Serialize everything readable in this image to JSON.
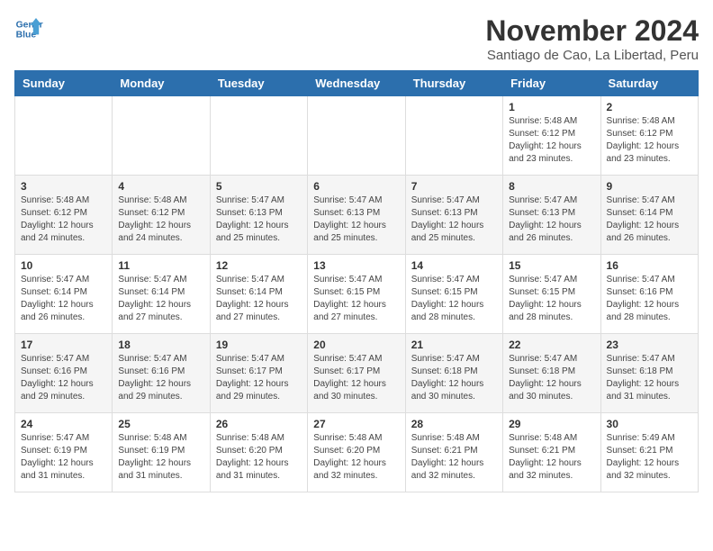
{
  "logo": {
    "text_line1": "General",
    "text_line2": "Blue"
  },
  "header": {
    "title": "November 2024",
    "subtitle": "Santiago de Cao, La Libertad, Peru"
  },
  "weekdays": [
    "Sunday",
    "Monday",
    "Tuesday",
    "Wednesday",
    "Thursday",
    "Friday",
    "Saturday"
  ],
  "weeks": [
    [
      {
        "day": "",
        "info": ""
      },
      {
        "day": "",
        "info": ""
      },
      {
        "day": "",
        "info": ""
      },
      {
        "day": "",
        "info": ""
      },
      {
        "day": "",
        "info": ""
      },
      {
        "day": "1",
        "info": "Sunrise: 5:48 AM\nSunset: 6:12 PM\nDaylight: 12 hours\nand 23 minutes."
      },
      {
        "day": "2",
        "info": "Sunrise: 5:48 AM\nSunset: 6:12 PM\nDaylight: 12 hours\nand 23 minutes."
      }
    ],
    [
      {
        "day": "3",
        "info": "Sunrise: 5:48 AM\nSunset: 6:12 PM\nDaylight: 12 hours\nand 24 minutes."
      },
      {
        "day": "4",
        "info": "Sunrise: 5:48 AM\nSunset: 6:12 PM\nDaylight: 12 hours\nand 24 minutes."
      },
      {
        "day": "5",
        "info": "Sunrise: 5:47 AM\nSunset: 6:13 PM\nDaylight: 12 hours\nand 25 minutes."
      },
      {
        "day": "6",
        "info": "Sunrise: 5:47 AM\nSunset: 6:13 PM\nDaylight: 12 hours\nand 25 minutes."
      },
      {
        "day": "7",
        "info": "Sunrise: 5:47 AM\nSunset: 6:13 PM\nDaylight: 12 hours\nand 25 minutes."
      },
      {
        "day": "8",
        "info": "Sunrise: 5:47 AM\nSunset: 6:13 PM\nDaylight: 12 hours\nand 26 minutes."
      },
      {
        "day": "9",
        "info": "Sunrise: 5:47 AM\nSunset: 6:14 PM\nDaylight: 12 hours\nand 26 minutes."
      }
    ],
    [
      {
        "day": "10",
        "info": "Sunrise: 5:47 AM\nSunset: 6:14 PM\nDaylight: 12 hours\nand 26 minutes."
      },
      {
        "day": "11",
        "info": "Sunrise: 5:47 AM\nSunset: 6:14 PM\nDaylight: 12 hours\nand 27 minutes."
      },
      {
        "day": "12",
        "info": "Sunrise: 5:47 AM\nSunset: 6:14 PM\nDaylight: 12 hours\nand 27 minutes."
      },
      {
        "day": "13",
        "info": "Sunrise: 5:47 AM\nSunset: 6:15 PM\nDaylight: 12 hours\nand 27 minutes."
      },
      {
        "day": "14",
        "info": "Sunrise: 5:47 AM\nSunset: 6:15 PM\nDaylight: 12 hours\nand 28 minutes."
      },
      {
        "day": "15",
        "info": "Sunrise: 5:47 AM\nSunset: 6:15 PM\nDaylight: 12 hours\nand 28 minutes."
      },
      {
        "day": "16",
        "info": "Sunrise: 5:47 AM\nSunset: 6:16 PM\nDaylight: 12 hours\nand 28 minutes."
      }
    ],
    [
      {
        "day": "17",
        "info": "Sunrise: 5:47 AM\nSunset: 6:16 PM\nDaylight: 12 hours\nand 29 minutes."
      },
      {
        "day": "18",
        "info": "Sunrise: 5:47 AM\nSunset: 6:16 PM\nDaylight: 12 hours\nand 29 minutes."
      },
      {
        "day": "19",
        "info": "Sunrise: 5:47 AM\nSunset: 6:17 PM\nDaylight: 12 hours\nand 29 minutes."
      },
      {
        "day": "20",
        "info": "Sunrise: 5:47 AM\nSunset: 6:17 PM\nDaylight: 12 hours\nand 30 minutes."
      },
      {
        "day": "21",
        "info": "Sunrise: 5:47 AM\nSunset: 6:18 PM\nDaylight: 12 hours\nand 30 minutes."
      },
      {
        "day": "22",
        "info": "Sunrise: 5:47 AM\nSunset: 6:18 PM\nDaylight: 12 hours\nand 30 minutes."
      },
      {
        "day": "23",
        "info": "Sunrise: 5:47 AM\nSunset: 6:18 PM\nDaylight: 12 hours\nand 31 minutes."
      }
    ],
    [
      {
        "day": "24",
        "info": "Sunrise: 5:47 AM\nSunset: 6:19 PM\nDaylight: 12 hours\nand 31 minutes."
      },
      {
        "day": "25",
        "info": "Sunrise: 5:48 AM\nSunset: 6:19 PM\nDaylight: 12 hours\nand 31 minutes."
      },
      {
        "day": "26",
        "info": "Sunrise: 5:48 AM\nSunset: 6:20 PM\nDaylight: 12 hours\nand 31 minutes."
      },
      {
        "day": "27",
        "info": "Sunrise: 5:48 AM\nSunset: 6:20 PM\nDaylight: 12 hours\nand 32 minutes."
      },
      {
        "day": "28",
        "info": "Sunrise: 5:48 AM\nSunset: 6:21 PM\nDaylight: 12 hours\nand 32 minutes."
      },
      {
        "day": "29",
        "info": "Sunrise: 5:48 AM\nSunset: 6:21 PM\nDaylight: 12 hours\nand 32 minutes."
      },
      {
        "day": "30",
        "info": "Sunrise: 5:49 AM\nSunset: 6:21 PM\nDaylight: 12 hours\nand 32 minutes."
      }
    ]
  ]
}
